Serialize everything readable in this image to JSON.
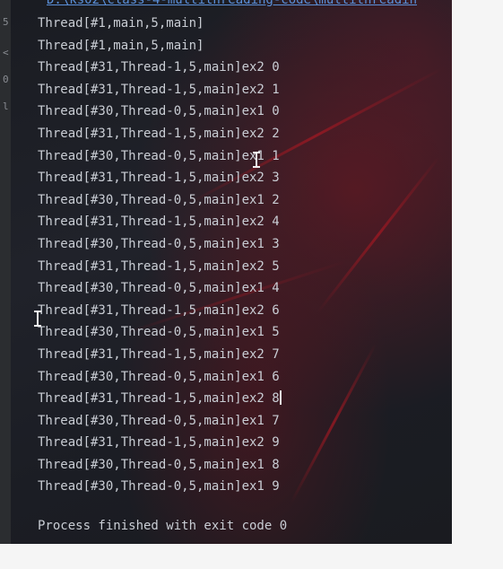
{
  "gutter": {
    "marks": [
      "5",
      "<",
      "0",
      "l"
    ]
  },
  "console": {
    "path_text": "D:\\ks02\\class-4-multithreading-code\\multithreadin",
    "lines": [
      "Thread[#1,main,5,main]",
      "Thread[#1,main,5,main]",
      "Thread[#31,Thread-1,5,main]ex2 0",
      "Thread[#31,Thread-1,5,main]ex2 1",
      "Thread[#30,Thread-0,5,main]ex1 0",
      "Thread[#31,Thread-1,5,main]ex2 2",
      "Thread[#30,Thread-0,5,main]ex1 1",
      "Thread[#31,Thread-1,5,main]ex2 3",
      "Thread[#30,Thread-0,5,main]ex1 2",
      "Thread[#31,Thread-1,5,main]ex2 4",
      "Thread[#30,Thread-0,5,main]ex1 3",
      "Thread[#31,Thread-1,5,main]ex2 5",
      "Thread[#30,Thread-0,5,main]ex1 4",
      "Thread[#31,Thread-1,5,main]ex2 6",
      "Thread[#30,Thread-0,5,main]ex1 5",
      "Thread[#31,Thread-1,5,main]ex2 7",
      "Thread[#30,Thread-0,5,main]ex1 6",
      "Thread[#31,Thread-1,5,main]ex2 8",
      "Thread[#30,Thread-0,5,main]ex1 7",
      "Thread[#31,Thread-1,5,main]ex2 9",
      "Thread[#30,Thread-0,5,main]ex1 8",
      "Thread[#30,Thread-0,5,main]ex1 9"
    ],
    "finish_text": "Process finished with exit code 0",
    "colors": {
      "text": "#c9cdd4",
      "link": "#5a8fd8",
      "background": "#1b1d24"
    }
  }
}
